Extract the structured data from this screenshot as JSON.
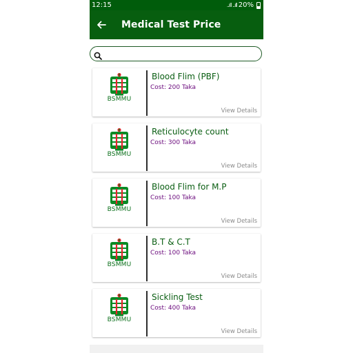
{
  "status_bar": {
    "time": "12:15",
    "signal": "..ıll ..ıll",
    "battery": "20%"
  },
  "app_bar": {
    "title": "Medical Test Price",
    "back_icon": "arrow-left-icon"
  },
  "search": {
    "placeholder": "",
    "value": "",
    "icon": "search-icon"
  },
  "colors": {
    "primary": "#075e0f",
    "status_bar": "#005c0b",
    "test_name": "#0a5e12",
    "cost": "#6a0a7c",
    "view_details": "#8a8a8a"
  },
  "tests": [
    {
      "logo_text": "BSMMU",
      "name": "Blood Flim (PBF)",
      "cost": "Cost: 200 Taka",
      "action": "View Details"
    },
    {
      "logo_text": "BSMMU",
      "name": "Reticulocyte count",
      "cost": "Cost: 300 Taka",
      "action": "View Details"
    },
    {
      "logo_text": "BSMMU",
      "name": "Blood Flim for M.P",
      "cost": "Cost: 100 Taka",
      "action": "View Details"
    },
    {
      "logo_text": "BSMMU",
      "name": "B.T & C.T",
      "cost": "Cost: 100 Taka",
      "action": "View Details"
    },
    {
      "logo_text": "BSMMU",
      "name": "Sickling Test",
      "cost": "Cost: 400 Taka",
      "action": "View Details"
    }
  ]
}
